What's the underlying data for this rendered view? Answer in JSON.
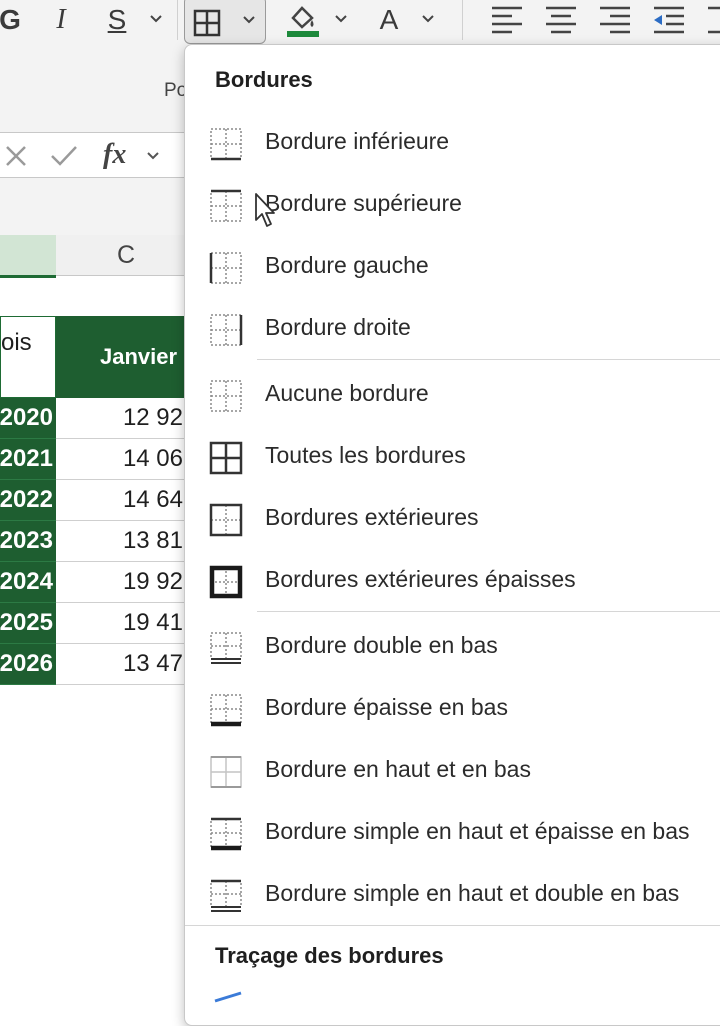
{
  "ribbon": {
    "bold_glyph": "G",
    "italic_glyph": "I",
    "underline_glyph": "S",
    "font_color_glyph": "A",
    "group_label": "Po"
  },
  "formula_bar": {
    "fx_label": "fx"
  },
  "sheet": {
    "column_c": "C",
    "header_mois": "ois",
    "header_janvier": "Janvier",
    "rows": [
      {
        "year": "2020",
        "value": "12 92"
      },
      {
        "year": "2021",
        "value": "14 06"
      },
      {
        "year": "2022",
        "value": "14 64"
      },
      {
        "year": "2023",
        "value": "13 81"
      },
      {
        "year": "2024",
        "value": "19 92"
      },
      {
        "year": "2025",
        "value": "19 41"
      },
      {
        "year": "2026",
        "value": "13 47"
      }
    ]
  },
  "menu": {
    "title": "Bordures",
    "items": [
      {
        "label": "Bordure inférieure",
        "icon": "border-bottom-icon"
      },
      {
        "label": "Bordure supérieure",
        "icon": "border-top-icon"
      },
      {
        "label": "Bordure gauche",
        "icon": "border-left-icon"
      },
      {
        "label": "Bordure droite",
        "icon": "border-right-icon"
      },
      {
        "label": "Aucune bordure",
        "icon": "no-border-icon"
      },
      {
        "label": "Toutes les bordures",
        "icon": "all-borders-icon"
      },
      {
        "label": "Bordures extérieures",
        "icon": "outside-borders-icon"
      },
      {
        "label": "Bordures extérieures épaisses",
        "icon": "thick-outside-borders-icon"
      },
      {
        "label": "Bordure double en bas",
        "icon": "bottom-double-border-icon"
      },
      {
        "label": "Bordure épaisse en bas",
        "icon": "thick-bottom-border-icon"
      },
      {
        "label": "Bordure en haut et en bas",
        "icon": "top-and-bottom-border-icon"
      },
      {
        "label": "Bordure simple en haut et épaisse en bas",
        "icon": "top-and-thick-bottom-border-icon"
      },
      {
        "label": "Bordure simple en haut et double en bas",
        "icon": "top-and-double-bottom-border-icon"
      }
    ],
    "section2_title": "Traçage des bordures"
  },
  "colors": {
    "accent_green": "#1e5e30",
    "fill_green": "#1e8a3c"
  }
}
